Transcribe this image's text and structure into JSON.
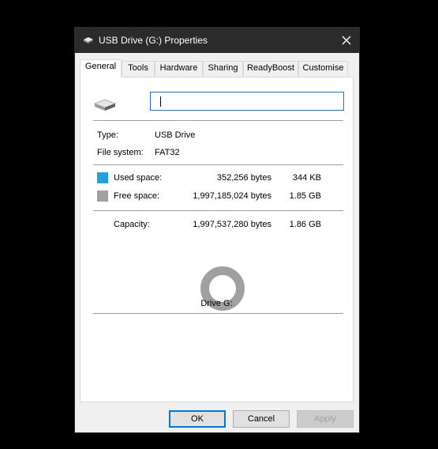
{
  "window": {
    "title": "USB Drive (G:) Properties"
  },
  "tabs": [
    {
      "label": "General",
      "active": true
    },
    {
      "label": "Tools",
      "active": false
    },
    {
      "label": "Hardware",
      "active": false
    },
    {
      "label": "Sharing",
      "active": false
    },
    {
      "label": "ReadyBoost",
      "active": false
    },
    {
      "label": "Customise",
      "active": false
    }
  ],
  "general": {
    "volume_name_value": "",
    "type_label": "Type:",
    "type_value": "USB Drive",
    "filesystem_label": "File system:",
    "filesystem_value": "FAT32",
    "used": {
      "label": "Used space:",
      "bytes": "352,256 bytes",
      "size": "344 KB",
      "color": "#26a0da"
    },
    "free": {
      "label": "Free space:",
      "bytes": "1,997,185,024 bytes",
      "size": "1.85 GB",
      "color": "#a0a0a0"
    },
    "capacity": {
      "label": "Capacity:",
      "bytes": "1,997,537,280 bytes",
      "size": "1.86 GB"
    },
    "used_fraction": 0.000176,
    "drive_label": "Drive G:"
  },
  "buttons": {
    "ok": "OK",
    "cancel": "Cancel",
    "apply": "Apply"
  },
  "icons": {
    "title": "usb-drive-icon",
    "close": "close-icon",
    "drive": "usb-drive-icon"
  }
}
